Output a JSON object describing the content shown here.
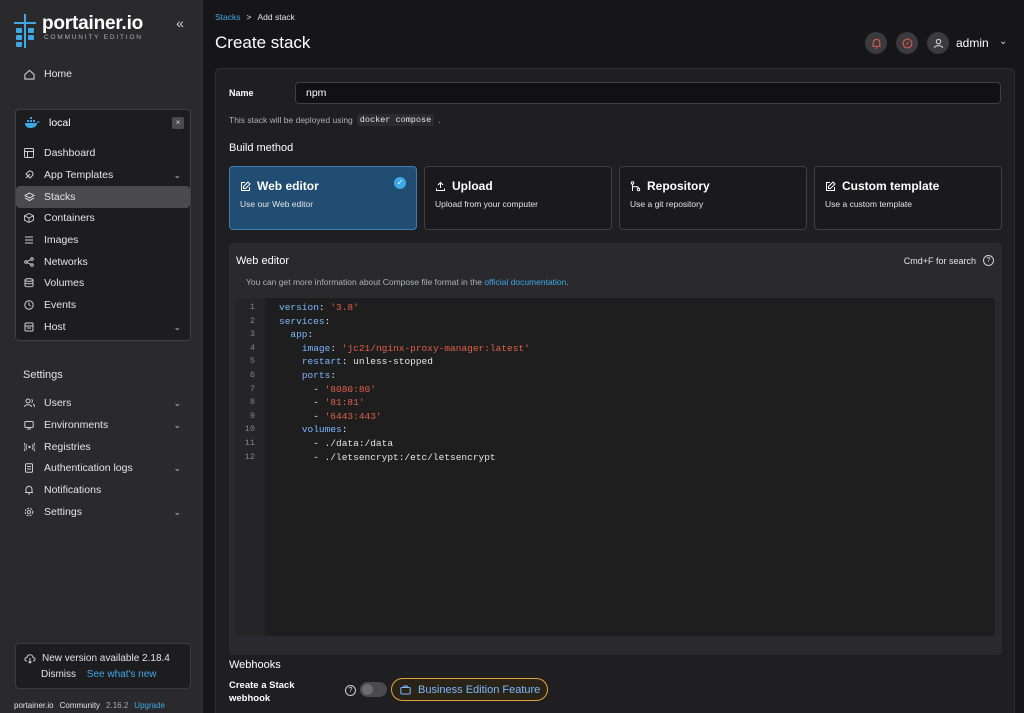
{
  "sidebar": {
    "logo_name": "portainer.io",
    "logo_sub": "COMMUNITY EDITION",
    "home": "Home",
    "environment": {
      "name": "local"
    },
    "env_items": [
      {
        "label": "Dashboard",
        "icon": "dashboard-icon"
      },
      {
        "label": "App Templates",
        "icon": "rocket-icon"
      },
      {
        "label": "Stacks",
        "icon": "layers-icon"
      },
      {
        "label": "Containers",
        "icon": "box-icon"
      },
      {
        "label": "Images",
        "icon": "list-icon"
      },
      {
        "label": "Networks",
        "icon": "share-icon"
      },
      {
        "label": "Volumes",
        "icon": "database-icon"
      },
      {
        "label": "Events",
        "icon": "clock-icon"
      },
      {
        "label": "Host",
        "icon": "host-icon"
      }
    ],
    "settings_title": "Settings",
    "settings_items": [
      {
        "label": "Users",
        "icon": "users-icon"
      },
      {
        "label": "Environments",
        "icon": "globe-icon"
      },
      {
        "label": "Registries",
        "icon": "radio-icon"
      },
      {
        "label": "Authentication logs",
        "icon": "log-icon"
      },
      {
        "label": "Notifications",
        "icon": "bell-icon"
      },
      {
        "label": "Settings",
        "icon": "gear-icon"
      }
    ],
    "update": {
      "text": "New version available 2.18.4",
      "dismiss": "Dismiss",
      "link": "See what's new"
    },
    "footer": {
      "brand": "portainer.io",
      "edition": "Community",
      "version": "2.16.2",
      "upgrade": "Upgrade"
    }
  },
  "header": {
    "breadcrumb_link": "Stacks",
    "breadcrumb_sep": ">",
    "breadcrumb_current": "Add stack",
    "title": "Create stack",
    "user": "admin"
  },
  "form": {
    "name_label": "Name",
    "name_value": "npm",
    "deploy_note_prefix": "This stack will be deployed using",
    "deploy_note_code": "docker compose",
    "deploy_note_suffix": ".",
    "build_method_title": "Build method",
    "build_methods": [
      {
        "title": "Web editor",
        "desc": "Use our Web editor",
        "selected": true
      },
      {
        "title": "Upload",
        "desc": "Upload from your computer",
        "selected": false
      },
      {
        "title": "Repository",
        "desc": "Use a git repository",
        "selected": false
      },
      {
        "title": "Custom template",
        "desc": "Use a custom template",
        "selected": false
      }
    ]
  },
  "editor": {
    "title": "Web editor",
    "search_hint": "Cmd+F for search",
    "info_prefix": "You can get more information about Compose file format in the",
    "info_link": "official documentation",
    "info_suffix": ".",
    "lines": [
      {
        "n": "1",
        "parts": [
          [
            "k",
            "version"
          ],
          [
            "v",
            ": "
          ],
          [
            "s",
            "'3.8'"
          ]
        ]
      },
      {
        "n": "2",
        "parts": [
          [
            "k",
            "services"
          ],
          [
            "v",
            ":"
          ]
        ]
      },
      {
        "n": "3",
        "parts": [
          [
            "v",
            "  "
          ],
          [
            "k",
            "app"
          ],
          [
            "v",
            ":"
          ]
        ]
      },
      {
        "n": "4",
        "parts": [
          [
            "v",
            "    "
          ],
          [
            "k",
            "image"
          ],
          [
            "v",
            ": "
          ],
          [
            "s",
            "'jc21/nginx-proxy-manager:latest'"
          ]
        ]
      },
      {
        "n": "5",
        "parts": [
          [
            "v",
            "    "
          ],
          [
            "k",
            "restart"
          ],
          [
            "v",
            ": unless-stopped"
          ]
        ]
      },
      {
        "n": "6",
        "parts": [
          [
            "v",
            "    "
          ],
          [
            "k",
            "ports"
          ],
          [
            "v",
            ":"
          ]
        ]
      },
      {
        "n": "7",
        "parts": [
          [
            "v",
            "      - "
          ],
          [
            "s",
            "'8080:80'"
          ]
        ]
      },
      {
        "n": "8",
        "parts": [
          [
            "v",
            "      - "
          ],
          [
            "s",
            "'81:81'"
          ]
        ]
      },
      {
        "n": "9",
        "parts": [
          [
            "v",
            "      - "
          ],
          [
            "s",
            "'6443:443'"
          ]
        ]
      },
      {
        "n": "10",
        "parts": [
          [
            "v",
            "    "
          ],
          [
            "k",
            "volumes"
          ],
          [
            "v",
            ":"
          ]
        ]
      },
      {
        "n": "11",
        "parts": [
          [
            "v",
            "      - ./data:/data"
          ]
        ]
      },
      {
        "n": "12",
        "parts": [
          [
            "v",
            "      - ./letsencrypt:/etc/letsencrypt"
          ]
        ]
      }
    ]
  },
  "webhooks": {
    "title": "Webhooks",
    "label": "Create a Stack webhook",
    "badge": "Business Edition Feature"
  }
}
